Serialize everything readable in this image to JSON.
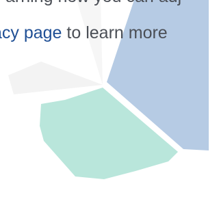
{
  "notice": {
    "line1": "arning how you can adj",
    "link_text": "acy page",
    "line2_rest": " to learn more"
  },
  "graphic": {
    "type": "pie-fragments",
    "colors": {
      "blue": "#b6cbe4",
      "green": "#b9e6db",
      "faint_gray": "#f5f5f5",
      "text": "#4b4f56",
      "link": "#1f4f95"
    }
  }
}
